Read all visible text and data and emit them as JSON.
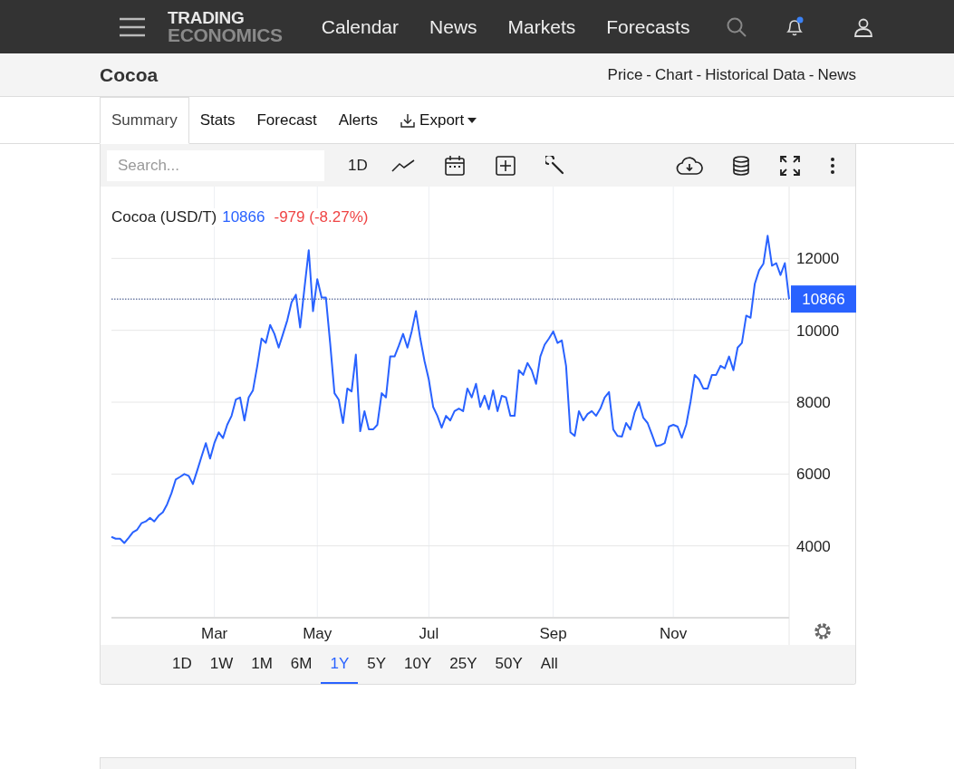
{
  "navbar": {
    "logo_top": "TRADING",
    "logo_bottom": "ECONOMICS",
    "links": [
      "Calendar",
      "News",
      "Markets",
      "Forecasts"
    ],
    "notification_dot": true
  },
  "title_bar": {
    "title": "Cocoa",
    "links": [
      "Price",
      "Chart",
      "Historical Data",
      "News"
    ],
    "separator": "-"
  },
  "tabs": [
    {
      "label": "Summary",
      "selected": true,
      "kind": "tab"
    },
    {
      "label": "Stats",
      "selected": false,
      "kind": "tab"
    },
    {
      "label": "Forecast",
      "selected": false,
      "kind": "tab"
    },
    {
      "label": "Alerts",
      "selected": false,
      "kind": "tab"
    },
    {
      "label": "Export",
      "selected": false,
      "kind": "dropdown"
    }
  ],
  "toolbar": {
    "search": {
      "placeholder": "Search..."
    },
    "interval": "1D"
  },
  "chart": {
    "legend": {
      "price": "10866",
      "change": "-979 (-8.27%)"
    },
    "price_tag": "10866",
    "chart_data": {
      "type": "line",
      "grid": true,
      "ref_lines": [
        {
          "axis": "y",
          "value": 10870
        }
      ],
      "ylim": [
        2000,
        14000
      ],
      "yticks": [
        4000,
        6000,
        8000,
        10000,
        12000
      ],
      "categories": [
        null,
        null,
        null,
        null,
        null,
        null,
        null,
        null,
        null,
        null,
        null,
        null,
        null,
        null,
        null,
        null,
        null,
        null,
        null,
        null,
        null,
        null,
        null,
        null,
        "Mar",
        null,
        null,
        null,
        null,
        null,
        null,
        null,
        null,
        null,
        null,
        null,
        null,
        null,
        null,
        null,
        null,
        null,
        null,
        null,
        null,
        null,
        null,
        null,
        "May",
        null,
        null,
        null,
        null,
        null,
        null,
        null,
        null,
        null,
        null,
        null,
        null,
        null,
        null,
        null,
        null,
        null,
        null,
        null,
        null,
        null,
        null,
        null,
        null,
        null,
        "Jul",
        null,
        null,
        null,
        null,
        null,
        null,
        null,
        null,
        null,
        null,
        null,
        null,
        null,
        null,
        null,
        null,
        null,
        null,
        null,
        null,
        null,
        null,
        null,
        null,
        null,
        null,
        null,
        null,
        "Sep",
        null,
        null,
        null,
        null,
        null,
        null,
        null,
        null,
        null,
        null,
        null,
        null,
        null,
        null,
        null,
        null,
        null,
        null,
        null,
        null,
        null,
        null,
        null,
        null,
        null,
        null,
        null,
        "Nov",
        null,
        null,
        null,
        null,
        null,
        null,
        null,
        null,
        null,
        null,
        null,
        null,
        null,
        null,
        null,
        null,
        null,
        null,
        null,
        null,
        null,
        null,
        null,
        null,
        null,
        null,
        null
      ],
      "series": [
        {
          "name": "Cocoa (USD/T)",
          "color": "#2962ff",
          "values": [
            4250,
            4200,
            4200,
            4080,
            4220,
            4380,
            4450,
            4630,
            4680,
            4780,
            4680,
            4840,
            4940,
            5160,
            5470,
            5850,
            5920,
            6000,
            5950,
            5720,
            6100,
            6480,
            6860,
            6430,
            6860,
            7160,
            7000,
            7370,
            7620,
            8070,
            8130,
            7490,
            8130,
            8330,
            9010,
            9770,
            9650,
            10150,
            9900,
            9520,
            9900,
            10280,
            10780,
            10990,
            10080,
            11160,
            12230,
            10530,
            11420,
            10910,
            10910,
            9650,
            8250,
            8070,
            7420,
            8380,
            8300,
            9320,
            7190,
            7750,
            7240,
            7240,
            7370,
            8250,
            8130,
            9270,
            9270,
            9570,
            9900,
            9520,
            9970,
            10530,
            9770,
            9140,
            8630,
            7870,
            7620,
            7290,
            7620,
            7490,
            7750,
            7820,
            7750,
            8380,
            8130,
            8510,
            7870,
            8180,
            7800,
            8330,
            7750,
            8180,
            8130,
            7620,
            7620,
            8890,
            8760,
            9090,
            8890,
            8510,
            9270,
            9600,
            9770,
            9970,
            9650,
            9720,
            9010,
            7160,
            7060,
            7750,
            7490,
            7670,
            7750,
            7620,
            7820,
            8130,
            8280,
            7240,
            7060,
            7040,
            7420,
            7240,
            7720,
            8000,
            7570,
            7420,
            7110,
            6780,
            6800,
            6860,
            7320,
            7370,
            7320,
            7010,
            7370,
            8000,
            8760,
            8630,
            8380,
            8380,
            8760,
            8760,
            9010,
            8940,
            9270,
            8890,
            9520,
            9650,
            10410,
            10350,
            11290,
            11670,
            11850,
            12630,
            11800,
            11870,
            11540,
            11870,
            10870
          ]
        }
      ]
    }
  },
  "ranges": [
    {
      "label": "1D",
      "selected": false
    },
    {
      "label": "1W",
      "selected": false
    },
    {
      "label": "1M",
      "selected": false
    },
    {
      "label": "6M",
      "selected": false
    },
    {
      "label": "1Y",
      "selected": true
    },
    {
      "label": "5Y",
      "selected": false
    },
    {
      "label": "10Y",
      "selected": false
    },
    {
      "label": "25Y",
      "selected": false
    },
    {
      "label": "50Y",
      "selected": false
    },
    {
      "label": "All",
      "selected": false
    }
  ]
}
